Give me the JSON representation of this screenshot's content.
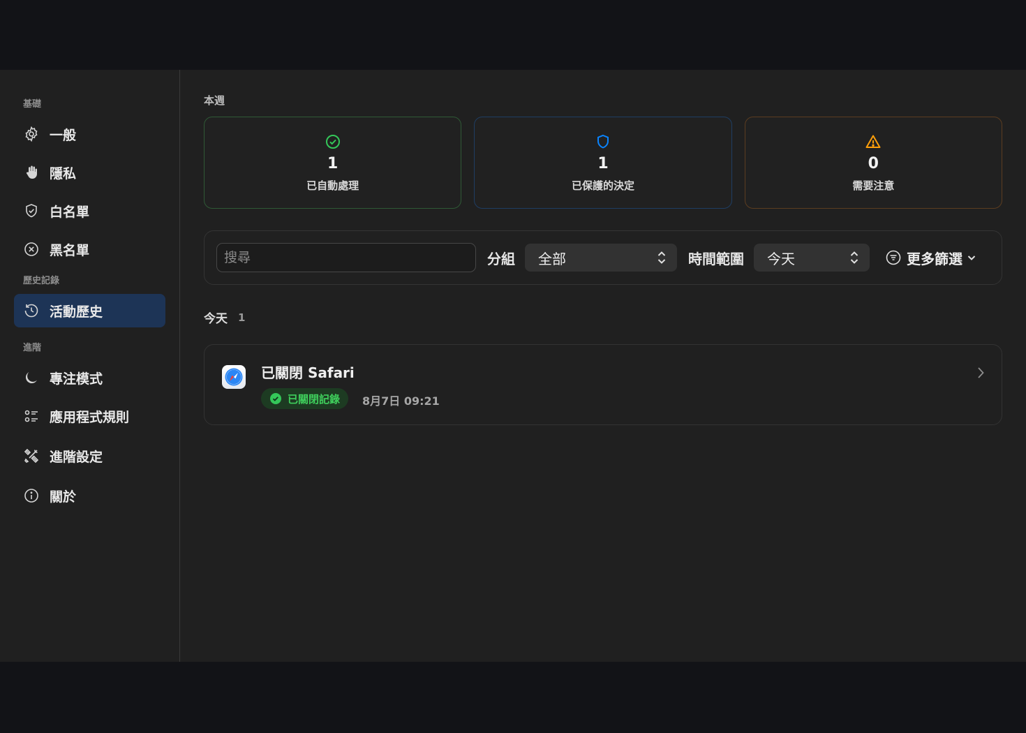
{
  "sidebar": {
    "sections": [
      {
        "label": "基礎",
        "items": [
          {
            "label": "一般",
            "icon": "gear-icon"
          },
          {
            "label": "隱私",
            "icon": "hand-icon"
          },
          {
            "label": "白名單",
            "icon": "shield-check-icon"
          },
          {
            "label": "黑名單",
            "icon": "x-circle-icon"
          }
        ]
      },
      {
        "label": "歷史記錄",
        "items": [
          {
            "label": "活動歷史",
            "icon": "history-icon",
            "active": true
          }
        ]
      },
      {
        "label": "進階",
        "items": [
          {
            "label": "專注模式",
            "icon": "moon-icon"
          },
          {
            "label": "應用程式規則",
            "icon": "list-rules-icon"
          },
          {
            "label": "進階設定",
            "icon": "tools-icon"
          },
          {
            "label": "關於",
            "icon": "info-icon"
          }
        ]
      }
    ]
  },
  "main": {
    "week_label": "本週",
    "stats": [
      {
        "value": "1",
        "label": "已自動處理",
        "icon": "check-circle-icon",
        "color": "#34c759"
      },
      {
        "value": "1",
        "label": "已保護的決定",
        "icon": "shield-icon",
        "color": "#0a84ff"
      },
      {
        "value": "0",
        "label": "需要注意",
        "icon": "warning-icon",
        "color": "#ff9f0a"
      }
    ],
    "filters": {
      "search_placeholder": "搜尋",
      "group_label": "分組",
      "group_value": "全部",
      "time_label": "時間範圍",
      "time_value": "今天",
      "more_label": "更多篩選"
    },
    "today": {
      "label": "今天",
      "count": "1"
    },
    "entries": [
      {
        "title": "已關閉 Safari",
        "badge": "已關閉記錄",
        "time": "8月7日 09:21",
        "app_icon": "safari-icon"
      }
    ]
  }
}
